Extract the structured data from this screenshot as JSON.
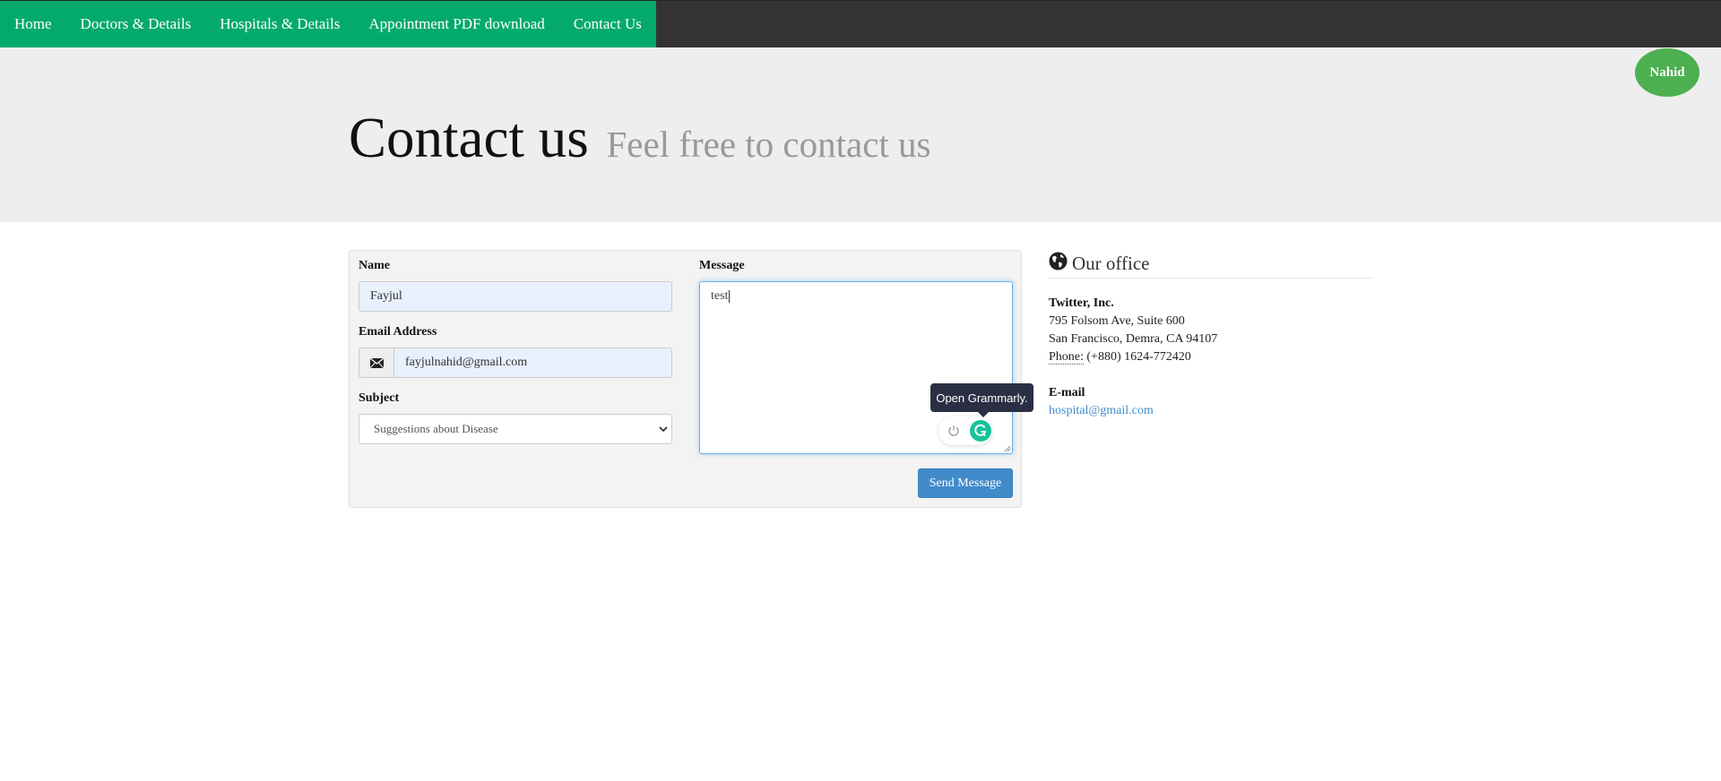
{
  "nav": {
    "items": [
      "Home",
      "Doctors & Details",
      "Hospitals & Details",
      "Appointment PDF download",
      "Contact Us"
    ],
    "brand_color": "#04AA6D",
    "bar_color": "#333333"
  },
  "user": {
    "name": "Nahid",
    "avatar_color": "#4CAF50"
  },
  "hero": {
    "title": "Contact us",
    "subtitle": "Feel free to contact us"
  },
  "form": {
    "name_label": "Name",
    "name_value": "Fayjul",
    "email_label": "Email Address",
    "email_value": "fayjulnahid@gmail.com",
    "email_icon": "envelope-icon",
    "subject_label": "Subject",
    "subject_value": "Suggestions about Disease",
    "message_label": "Message",
    "message_value": "test",
    "submit_label": "Send Message"
  },
  "grammarly": {
    "tooltip": "Open Grammarly.",
    "icons": [
      "power-icon",
      "grammarly-icon"
    ],
    "accent": "#15C39A"
  },
  "office": {
    "title": "Our office",
    "icon": "globe-icon",
    "company": "Twitter, Inc.",
    "address_line1": "795 Folsom Ave, Suite 600",
    "address_line2": "San Francisco, Demra, CA 94107",
    "phone_label": "Phone:",
    "phone_value": "(+880) 1624-772420",
    "email_label": "E-mail",
    "email_value": "hospital@gmail.com"
  }
}
